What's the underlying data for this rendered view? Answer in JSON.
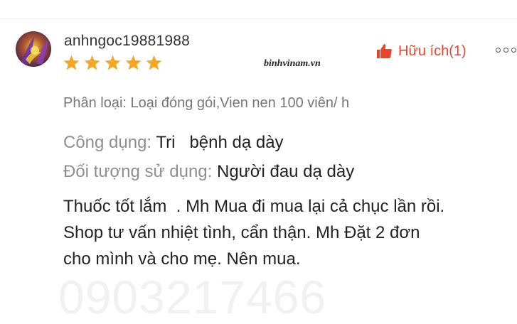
{
  "review": {
    "username": "anhngoc19881988",
    "rating": 5,
    "rating_max": 5,
    "helpful_label": "Hữu ích(1)",
    "classification": "Phân loại: Loại đóng gói,Vien nen 100 viên/ h",
    "attributes": [
      {
        "label": "Công dụng: ",
        "value": "Tri   bệnh dạ dày"
      },
      {
        "label": "Đối tượng sử dụng: ",
        "value": "Người đau dạ dày"
      }
    ],
    "text_lines": [
      "Thuốc tốt lắm  . Mh Mua đi mua lại cả chục lần rồi.",
      "Shop tư vấn nhiệt tình, cẩn thận. Mh Đặt 2 đơn",
      "cho mình và cho mẹ. Nên mua."
    ]
  },
  "watermark": {
    "site": "binhvinam.vn",
    "phone": "0903217466"
  },
  "icons": {
    "helpful": "thumbs-up-icon",
    "more": "more-options-icon",
    "star": "star-icon"
  },
  "colors": {
    "accent": "#e8452c",
    "star": "#f5a623",
    "muted_text": "#8e8e8e"
  }
}
